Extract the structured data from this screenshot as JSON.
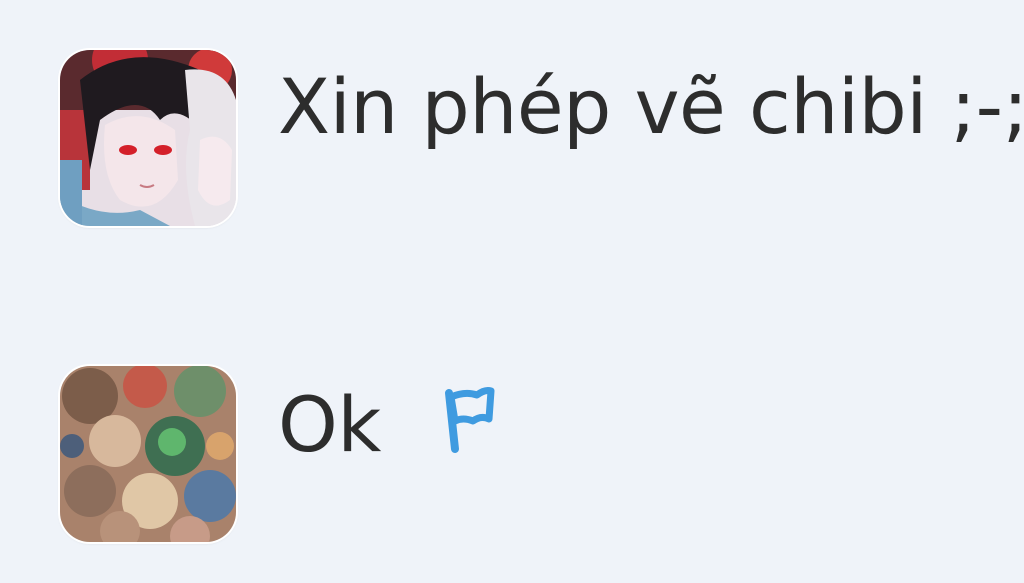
{
  "comments": [
    {
      "author_avatar_icon": "user-avatar-anime-red-eyes",
      "text": "Xin phép vẽ chibi ;-;"
    },
    {
      "author_avatar_icon": "user-avatar-collage",
      "text": "Ok",
      "action_icon": "flag-icon"
    }
  ],
  "colors": {
    "background": "#eff3f9",
    "text": "#2d2d2d",
    "flag": "#3f9be0"
  }
}
